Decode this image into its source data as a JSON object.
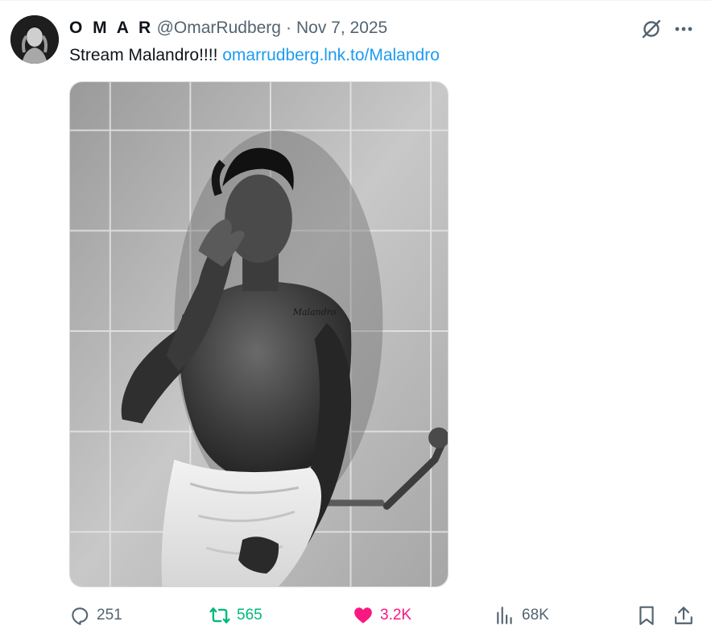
{
  "author": {
    "display_name": "O M A R",
    "handle": "@OmarRudberg",
    "separator": "·",
    "date": "Nov 7, 2025"
  },
  "post": {
    "text": "Stream Malandro!!!!",
    "link": "omarrudberg.lnk.to/Malandro"
  },
  "media": {
    "type": "photo",
    "tattoo_text": "Malandro"
  },
  "actions": {
    "replies": "251",
    "reposts": "565",
    "likes": "3.2K",
    "views": "68K"
  },
  "colors": {
    "link": "#1d9bf0",
    "repost": "#00ba7c",
    "like": "#f91880",
    "muted": "#536471"
  },
  "icons": [
    "grok-icon",
    "more-icon",
    "reply-icon",
    "repost-icon",
    "like-icon",
    "views-icon",
    "bookmark-icon",
    "share-icon"
  ]
}
